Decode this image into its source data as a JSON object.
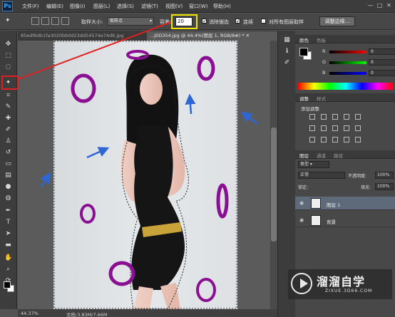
{
  "app": {
    "logo": "Ps"
  },
  "menubar": {
    "items": [
      "文件(F)",
      "编辑(E)",
      "图像(I)",
      "图层(L)",
      "选择(S)",
      "滤镜(T)",
      "视图(V)",
      "窗口(W)",
      "帮助(H)"
    ],
    "window_controls": [
      "—",
      "□",
      "✕"
    ]
  },
  "options": {
    "sample_size_label": "取样大小:",
    "sample_size_value": "取样点",
    "tolerance_label": "容差:",
    "tolerance_value": "20",
    "antialias_label": "消除锯齿",
    "contiguous_label": "连续",
    "sample_all_label": "对所有图层取样",
    "refine_edge_label": "调整边缘..."
  },
  "tabs": [
    {
      "label": "85edf6db1fa3020bb0d23dd54574e74d6.jpg",
      "active": false
    },
    {
      "label": "...J0D354.jpg @ 44.4%(图层 1, RGB/8#) * ✕",
      "active": true
    }
  ],
  "status": {
    "zoom": "44.37%",
    "doc": "文档:3.83M/7.66M"
  },
  "panels": {
    "color": {
      "tabs": [
        "颜色",
        "色板"
      ],
      "rows": [
        {
          "label": "R",
          "value": "0",
          "gradient": "linear-gradient(90deg,#000,#f00)"
        },
        {
          "label": "G",
          "value": "0",
          "gradient": "linear-gradient(90deg,#000,#0f0)"
        },
        {
          "label": "B",
          "value": "0",
          "gradient": "linear-gradient(90deg,#000,#00f)"
        }
      ]
    },
    "adjustments": {
      "tabs": [
        "调整",
        "样式"
      ],
      "title": "添加调整"
    },
    "layers": {
      "tabs": [
        "图层",
        "通道",
        "路径"
      ],
      "kind_label": "类型",
      "blend_mode": "正常",
      "opacity_label": "不透明度:",
      "opacity_value": "100%",
      "lock_label": "锁定:",
      "fill_label": "填充:",
      "fill_value": "100%",
      "items": [
        {
          "name": "图层 1",
          "selected": true
        },
        {
          "name": "背景",
          "selected": false
        }
      ]
    }
  },
  "watermark": {
    "main": "溜溜自学",
    "sub": "ZIXUE.3D66.COM"
  },
  "colors": {
    "annotation_red": "#e02020",
    "annotation_yellow": "#f2e600",
    "circle_purple": "#8a0f93",
    "arrow_blue": "#2f66d6"
  }
}
